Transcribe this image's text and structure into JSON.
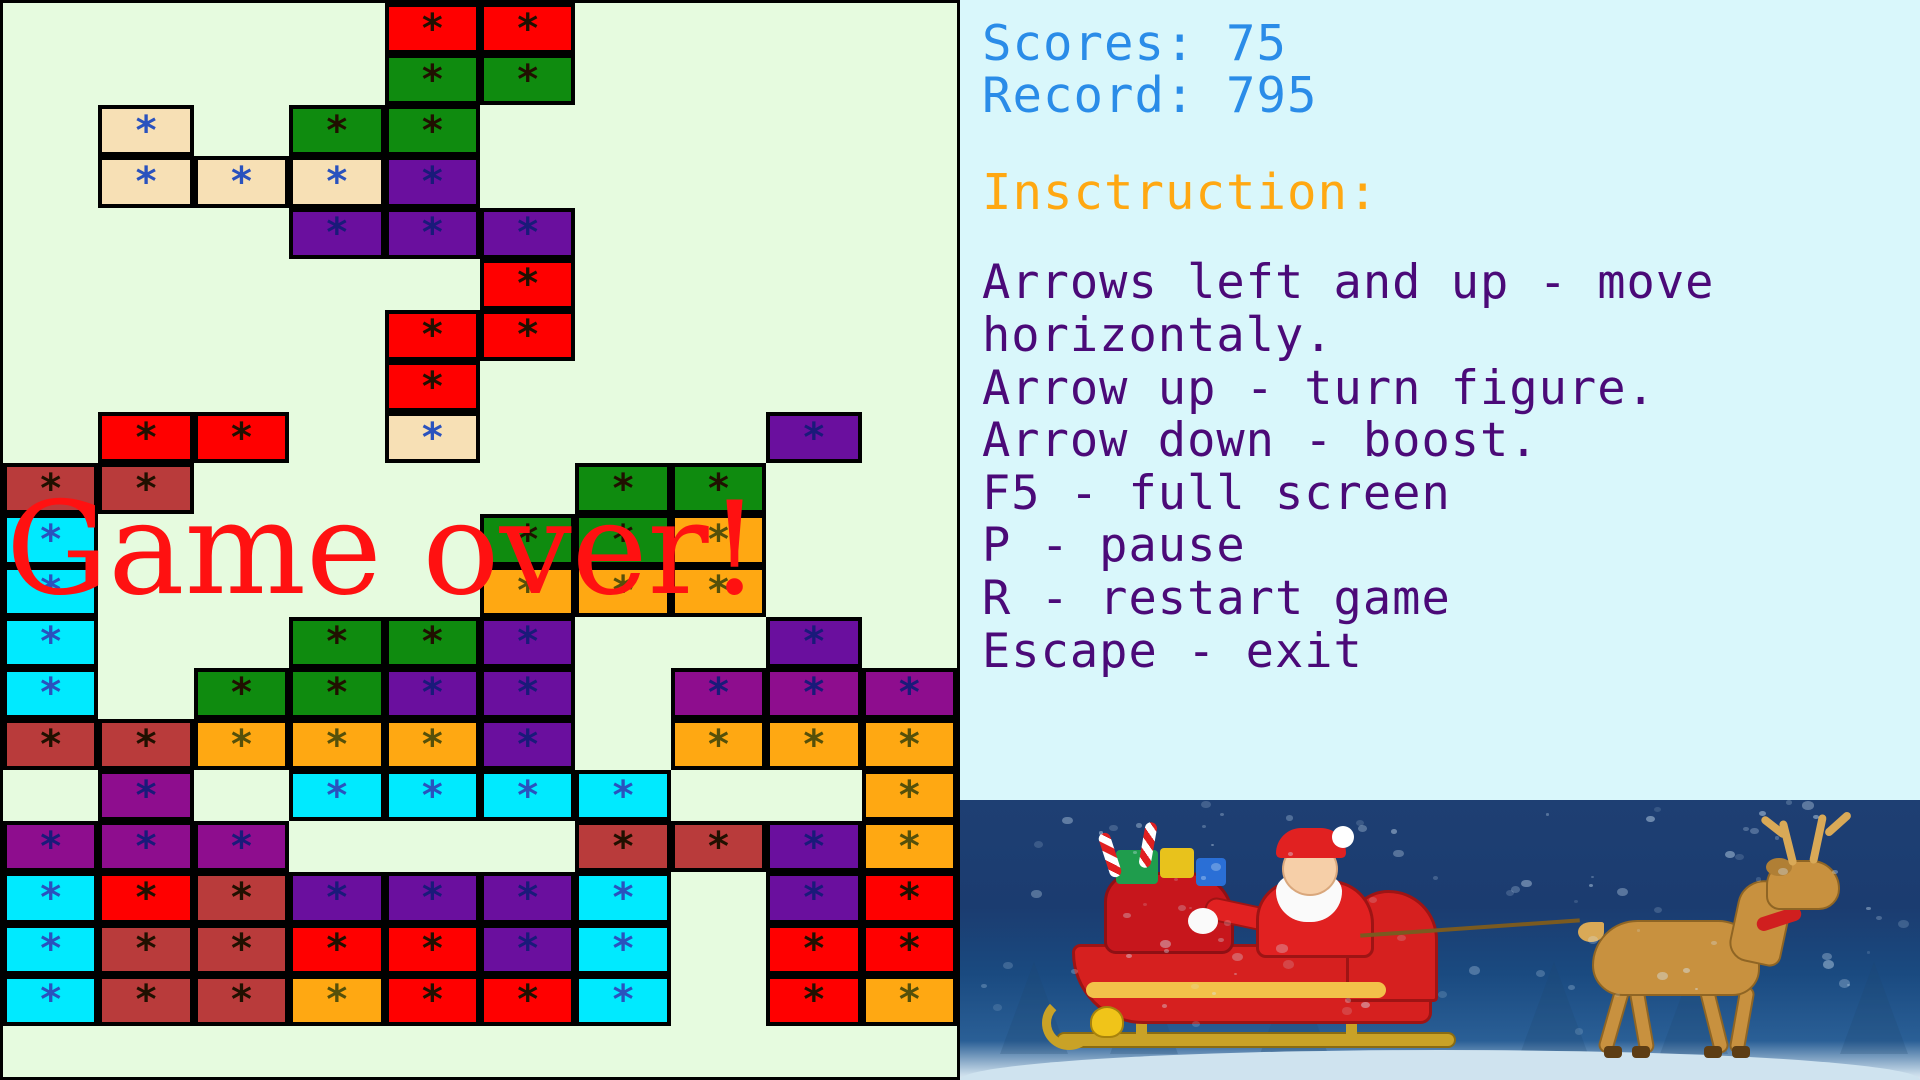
{
  "window": {
    "title": "Tetris Christmas Game"
  },
  "board": {
    "columns": 10,
    "rows": 21,
    "background_color": "#e6fbdf",
    "border_color": "#000000",
    "overlay_text": "Game over!",
    "overlay_color": "#ff1111",
    "palette": {
      "empty": "#e6fbdf",
      "red": "#ff0000",
      "green": "#0f8b0f",
      "purple": "#8e0d8e",
      "violet": "#6a0f9e",
      "cream": "#f7e0b5",
      "cyan": "#00eaff",
      "orange": "#ffa812",
      "brick": "#b93b3b"
    },
    "cell_glyph": "*",
    "cells": [
      [
        "empty",
        "empty",
        "empty",
        "empty",
        "red",
        "red",
        "empty",
        "empty",
        "empty",
        "empty"
      ],
      [
        "empty",
        "empty",
        "empty",
        "empty",
        "green",
        "green",
        "empty",
        "empty",
        "empty",
        "empty"
      ],
      [
        "empty",
        "cream",
        "empty",
        "green",
        "green",
        "empty",
        "empty",
        "empty",
        "empty",
        "empty"
      ],
      [
        "empty",
        "cream",
        "cream",
        "cream",
        "violet",
        "empty",
        "empty",
        "empty",
        "empty",
        "empty"
      ],
      [
        "empty",
        "empty",
        "empty",
        "violet",
        "violet",
        "violet",
        "empty",
        "empty",
        "empty",
        "empty"
      ],
      [
        "empty",
        "empty",
        "empty",
        "empty",
        "empty",
        "red",
        "empty",
        "empty",
        "empty",
        "empty"
      ],
      [
        "empty",
        "empty",
        "empty",
        "empty",
        "red",
        "red",
        "empty",
        "empty",
        "empty",
        "empty"
      ],
      [
        "empty",
        "empty",
        "empty",
        "empty",
        "red",
        "empty",
        "empty",
        "empty",
        "empty",
        "empty"
      ],
      [
        "empty",
        "red",
        "red",
        "empty",
        "cream",
        "empty",
        "empty",
        "empty",
        "violet",
        "empty"
      ],
      [
        "brick",
        "brick",
        "empty",
        "empty",
        "empty",
        "empty",
        "green",
        "green",
        "empty",
        "empty"
      ],
      [
        "cyan",
        "empty",
        "empty",
        "empty",
        "empty",
        "green",
        "green",
        "orange",
        "empty",
        "empty"
      ],
      [
        "cyan",
        "empty",
        "empty",
        "empty",
        "empty",
        "orange",
        "orange",
        "orange",
        "empty",
        "empty"
      ],
      [
        "cyan",
        "empty",
        "empty",
        "green",
        "green",
        "violet",
        "empty",
        "empty",
        "violet",
        "empty"
      ],
      [
        "cyan",
        "empty",
        "green",
        "green",
        "violet",
        "violet",
        "empty",
        "purple",
        "purple",
        "purple"
      ],
      [
        "brick",
        "brick",
        "orange",
        "orange",
        "orange",
        "violet",
        "empty",
        "orange",
        "orange",
        "orange"
      ],
      [
        "empty",
        "purple",
        "empty",
        "cyan",
        "cyan",
        "cyan",
        "cyan",
        "empty",
        "empty",
        "orange"
      ],
      [
        "purple",
        "purple",
        "purple",
        "empty",
        "empty",
        "empty",
        "brick",
        "brick",
        "violet",
        "orange"
      ],
      [
        "cyan",
        "red",
        "brick",
        "violet",
        "violet",
        "violet",
        "cyan",
        "empty",
        "violet",
        "red"
      ],
      [
        "cyan",
        "brick",
        "brick",
        "red",
        "red",
        "violet",
        "cyan",
        "empty",
        "red",
        "red"
      ],
      [
        "cyan",
        "brick",
        "brick",
        "orange",
        "red",
        "red",
        "cyan",
        "empty",
        "red",
        "orange"
      ],
      [
        "empty",
        "empty",
        "empty",
        "empty",
        "empty",
        "empty",
        "empty",
        "empty",
        "empty",
        "empty"
      ]
    ]
  },
  "panel": {
    "background_color": "#d9f7fb",
    "scores": {
      "score_line": "Scores: 75",
      "record_line": "Record: 795",
      "color": "#2a8ce8"
    },
    "instruction": {
      "title": "Insctruction:",
      "title_color": "#ffa812",
      "text_color": "#4b0a78",
      "lines": [
        "Arrows left and up - move",
        "horizontaly.",
        "Arrow up - turn figure.",
        "Arrow down - boost.",
        "F5 - full screen",
        "P - pause",
        "R - restart game",
        "Escape - exit"
      ]
    },
    "artwork": {
      "name": "santa-sleigh-reindeer-night-scene",
      "sky_color": "#1e3f73",
      "sleigh_color": "#d6201f",
      "reindeer_color": "#c8913f"
    }
  }
}
